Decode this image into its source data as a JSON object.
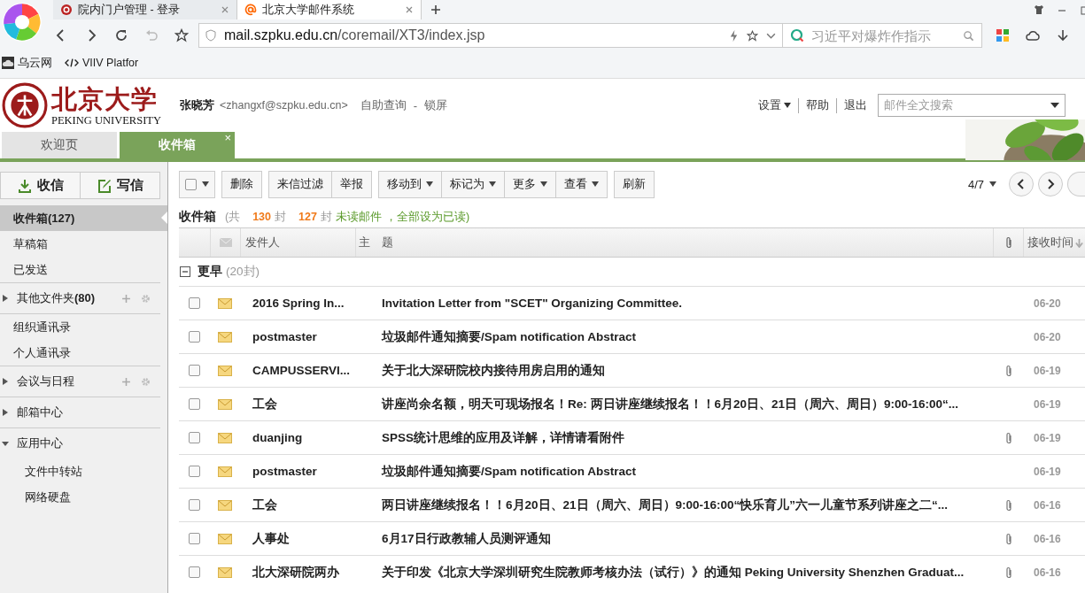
{
  "browser": {
    "tabs": [
      {
        "title": "院内门户管理 - 登录",
        "selected": false
      },
      {
        "title": "北京大学邮件系统",
        "selected": true
      }
    ],
    "url": {
      "host": "mail.szpku.edu.cn",
      "path": "/coremail/XT3/index.jsp"
    },
    "search": {
      "placeholder": "习近平对爆炸作指示"
    },
    "bookmarks": [
      {
        "label": "乌云网"
      },
      {
        "label": "VIIV Platfor"
      }
    ]
  },
  "header": {
    "logo_cn": "北京大学",
    "logo_en": "PEKING UNIVERSITY",
    "user": "张晓芳",
    "email": "<zhangxf@szpku.edu.cn>",
    "links": [
      "自助查询",
      "锁屏"
    ],
    "link_separator": "-",
    "menu": [
      {
        "label": "设置",
        "caret": true
      },
      {
        "label": "帮助",
        "caret": false
      },
      {
        "label": "退出",
        "caret": false
      }
    ],
    "search": {
      "placeholder": "邮件全文搜索"
    }
  },
  "app_tabs": [
    {
      "label": "欢迎页",
      "selected": false
    },
    {
      "label": "收件箱",
      "selected": true,
      "close": "×"
    }
  ],
  "sidebar": {
    "actions": [
      {
        "label": "收信"
      },
      {
        "label": "写信"
      }
    ],
    "sections": [
      {
        "kind": "list",
        "items": [
          {
            "label": "收件箱(127)",
            "selected": true
          },
          {
            "label": "草稿箱",
            "selected": false
          },
          {
            "label": "已发送",
            "selected": false
          }
        ]
      },
      {
        "kind": "folder",
        "label": "其他文件夹",
        "count": "(80)",
        "expanded": false,
        "tools": true
      },
      {
        "kind": "list",
        "items": [
          {
            "label": "组织通讯录",
            "selected": false
          },
          {
            "label": "个人通讯录",
            "selected": false
          }
        ]
      },
      {
        "kind": "folder",
        "label": "会议与日程",
        "expanded": false,
        "tools": true
      },
      {
        "kind": "folder",
        "label": "邮箱中心",
        "expanded": false,
        "tools": false
      },
      {
        "kind": "folder",
        "label": "应用中心",
        "expanded": true,
        "tools": false,
        "children": [
          {
            "label": "文件中转站"
          },
          {
            "label": "网络硬盘"
          }
        ]
      }
    ]
  },
  "toolbar": {
    "groups": [
      [
        {
          "label": "删除",
          "caret": false
        }
      ],
      [
        {
          "label": "来信过滤",
          "caret": false
        },
        {
          "label": "举报",
          "caret": false
        }
      ],
      [
        {
          "label": "移动到",
          "caret": true
        },
        {
          "label": "标记为",
          "caret": true
        },
        {
          "label": "更多",
          "caret": true
        },
        {
          "label": "查看",
          "caret": true
        }
      ],
      [
        {
          "label": "刷新",
          "caret": false
        }
      ]
    ],
    "pager": "4/7"
  },
  "summary": {
    "title": "收件箱",
    "segments": [
      {
        "kind": "muted",
        "text": "(共"
      },
      {
        "kind": "count",
        "text": "130"
      },
      {
        "kind": "muted",
        "text": "封"
      },
      {
        "kind": "count",
        "text": "127"
      },
      {
        "kind": "muted",
        "text": "封"
      },
      {
        "kind": "link",
        "text": "未读邮件"
      },
      {
        "kind": "link",
        "text": "，全部设为已读)"
      }
    ]
  },
  "table": {
    "columns": {
      "sender": "发件人",
      "subject": "主　题",
      "date": "接收时间"
    },
    "group": {
      "label": "更早",
      "count": "(20封)",
      "expanded": true
    },
    "rows": [
      {
        "sender": "2016 Spring In...",
        "subject": "Invitation Letter from \"SCET\" Organizing Committee.",
        "attachment": false,
        "date": "06-20",
        "checked": false
      },
      {
        "sender": "postmaster",
        "subject": "垃圾邮件通知摘要/Spam notification Abstract",
        "attachment": false,
        "date": "06-20",
        "checked": false
      },
      {
        "sender": "CAMPUSSERVI...",
        "subject": "关于北大深研院校内接待用房启用的通知",
        "attachment": true,
        "date": "06-19",
        "checked": false
      },
      {
        "sender": "工会",
        "subject": "讲座尚余名额，明天可现场报名！Re: 两日讲座继续报名！！6月20日、21日（周六、周日）9:00-16:00“...",
        "attachment": false,
        "date": "06-19",
        "checked": false
      },
      {
        "sender": "duanjing",
        "subject": "SPSS统计思维的应用及详解，详情请看附件",
        "attachment": true,
        "date": "06-19",
        "checked": false
      },
      {
        "sender": "postmaster",
        "subject": "垃圾邮件通知摘要/Spam notification Abstract",
        "attachment": false,
        "date": "06-19",
        "checked": false
      },
      {
        "sender": "工会",
        "subject": "两日讲座继续报名！！6月20日、21日（周六、周日）9:00-16:00“快乐育儿”六一儿童节系列讲座之二“...",
        "attachment": true,
        "date": "06-16",
        "checked": false
      },
      {
        "sender": "人事处",
        "subject": "6月17日行政教辅人员测评通知",
        "attachment": true,
        "date": "06-16",
        "checked": false
      },
      {
        "sender": "北大深研院两办",
        "subject": "关于印发《北京大学深圳研究生院教师考核办法（试行）》的通知 Peking University Shenzhen Graduat...",
        "attachment": true,
        "date": "06-16",
        "checked": false
      }
    ]
  }
}
